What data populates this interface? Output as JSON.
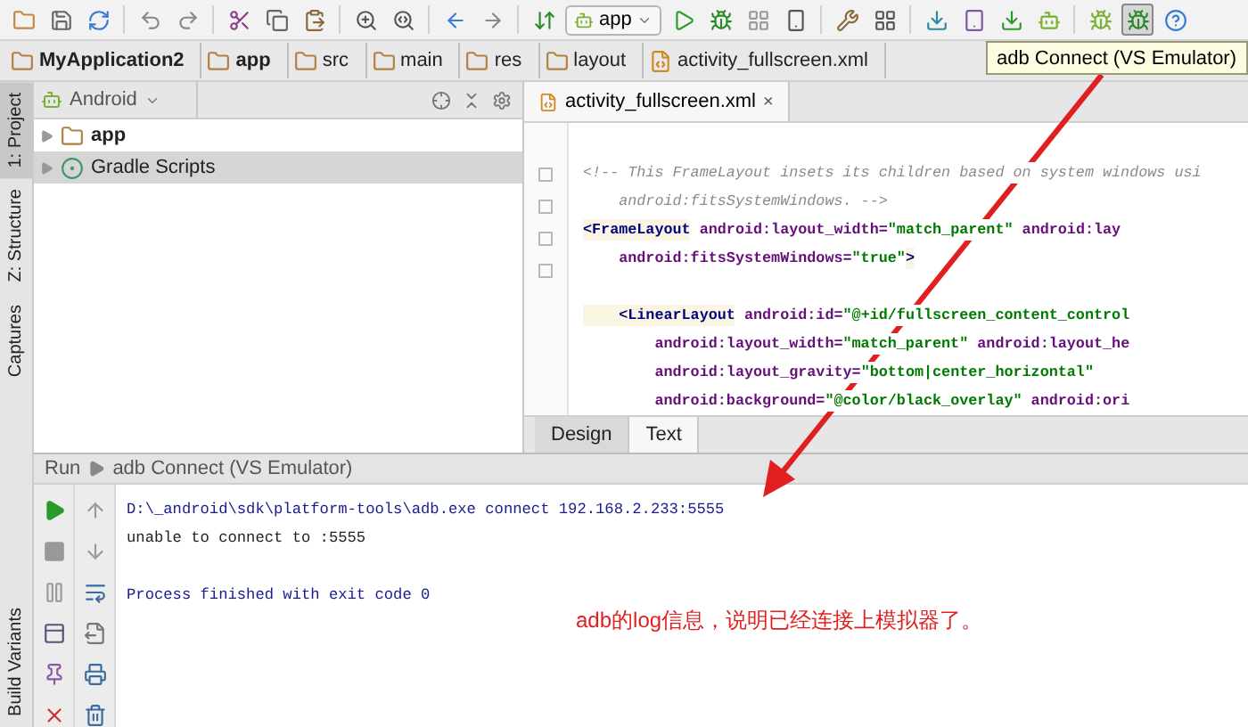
{
  "toolbar": {
    "run_config": "app",
    "tooltip": "adb Connect (VS Emulator)"
  },
  "breadcrumbs": [
    {
      "label": "MyApplication2",
      "kind": "project"
    },
    {
      "label": "app",
      "kind": "module"
    },
    {
      "label": "src",
      "kind": "folder"
    },
    {
      "label": "main",
      "kind": "folder"
    },
    {
      "label": "res",
      "kind": "res"
    },
    {
      "label": "layout",
      "kind": "folder"
    },
    {
      "label": "activity_fullscreen.xml",
      "kind": "file"
    }
  ],
  "side_tabs": [
    {
      "label": "1: Project",
      "selected": true
    },
    {
      "label": "Z: Structure",
      "selected": false
    },
    {
      "label": "Captures",
      "selected": false
    }
  ],
  "bottom_side_tab": {
    "label": "Build Variants"
  },
  "project_panel": {
    "view": "Android",
    "items": [
      {
        "label": "app",
        "kind": "module",
        "selected": false
      },
      {
        "label": "Gradle Scripts",
        "kind": "gradle",
        "selected": true
      }
    ]
  },
  "editor": {
    "tab": {
      "label": "activity_fullscreen.xml",
      "close": "×"
    },
    "lines": [
      {
        "spacer_before": false,
        "tokens": [
          {
            "kind": "comment",
            "text": "<!-- This FrameLayout insets its children based on system windows usi"
          }
        ]
      },
      {
        "spacer_before": false,
        "tokens": [
          {
            "kind": "comment",
            "text": "    android:fitsSystemWindows. -->"
          }
        ]
      },
      {
        "spacer_before": false,
        "tokens": [
          {
            "kind": "tag",
            "text": "<FrameLayout"
          },
          {
            "kind": "attr",
            "text": " android:layout_width="
          },
          {
            "kind": "value",
            "text": "\"match_parent\""
          },
          {
            "kind": "attr",
            "text": " android:lay"
          }
        ]
      },
      {
        "spacer_before": false,
        "tokens": [
          {
            "kind": "attr",
            "text": "    android:fitsSystemWindows="
          },
          {
            "kind": "value",
            "text": "\"true\""
          },
          {
            "kind": "tag",
            "text": ">"
          }
        ]
      },
      {
        "spacer_before": true,
        "tokens": [
          {
            "kind": "tag",
            "text": "    <LinearLayout"
          },
          {
            "kind": "attr",
            "text": " android:id="
          },
          {
            "kind": "value",
            "text": "\"@+id/fullscreen_content_control"
          }
        ]
      },
      {
        "spacer_before": false,
        "tokens": [
          {
            "kind": "attr",
            "text": "        android:layout_width="
          },
          {
            "kind": "value",
            "text": "\"match_parent\""
          },
          {
            "kind": "attr",
            "text": " android:layout_he"
          }
        ]
      },
      {
        "spacer_before": false,
        "tokens": [
          {
            "kind": "attr",
            "text": "        android:layout_gravity="
          },
          {
            "kind": "value",
            "text": "\"bottom|center_horizontal\""
          }
        ]
      },
      {
        "spacer_before": false,
        "tokens": [
          {
            "kind": "attr",
            "text": "        android:background="
          },
          {
            "kind": "value",
            "text": "\"@color/black_overlay\""
          },
          {
            "kind": "attr",
            "text": " android:ori"
          }
        ]
      }
    ],
    "view_tabs": [
      {
        "label": "Design",
        "selected": false
      },
      {
        "label": "Text",
        "selected": true
      }
    ]
  },
  "run_panel": {
    "title": "Run",
    "config": "adb Connect (VS Emulator)",
    "lines": [
      {
        "kind": "command",
        "text": "D:\\_android\\sdk\\platform-tools\\adb.exe connect 192.168.2.233:5555"
      },
      {
        "kind": "output",
        "text": "unable to connect to :5555"
      },
      {
        "kind": "system",
        "text": "Process finished with exit code 0"
      }
    ]
  },
  "annotation": "adb的log信息，说明已经连接上模拟器了。"
}
